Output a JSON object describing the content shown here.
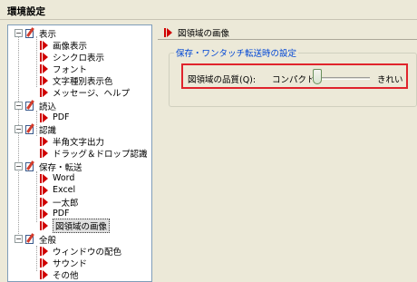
{
  "window": {
    "title": "環境設定"
  },
  "tree": {
    "groups": [
      {
        "label": "表示",
        "items": [
          "画像表示",
          "シンクロ表示",
          "フォント",
          "文字種別表示色",
          "メッセージ、ヘルプ"
        ]
      },
      {
        "label": "読込",
        "items": [
          "PDF"
        ]
      },
      {
        "label": "認識",
        "items": [
          "半角文字出力",
          "ドラッグ＆ドロップ認識"
        ]
      },
      {
        "label": "保存・転送",
        "items": [
          "Word",
          "Excel",
          "一太郎",
          "PDF",
          "図領域の画像"
        ]
      },
      {
        "label": "全般",
        "items": [
          "ウィンドウの配色",
          "サウンド",
          "その他"
        ]
      }
    ],
    "expander_symbol": "−",
    "selected_item": "図領域の画像"
  },
  "panel": {
    "title": "図領域の画像",
    "group_title": "保存・ワンタッチ転送時の設定",
    "quality_label": "図領域の品質(Q):",
    "slider": {
      "min_label": "コンパクト",
      "max_label": "きれい",
      "value": 0
    }
  },
  "colors": {
    "highlight": "#e0242c",
    "arrow": "#d00000",
    "group_title": "#0046d5"
  }
}
